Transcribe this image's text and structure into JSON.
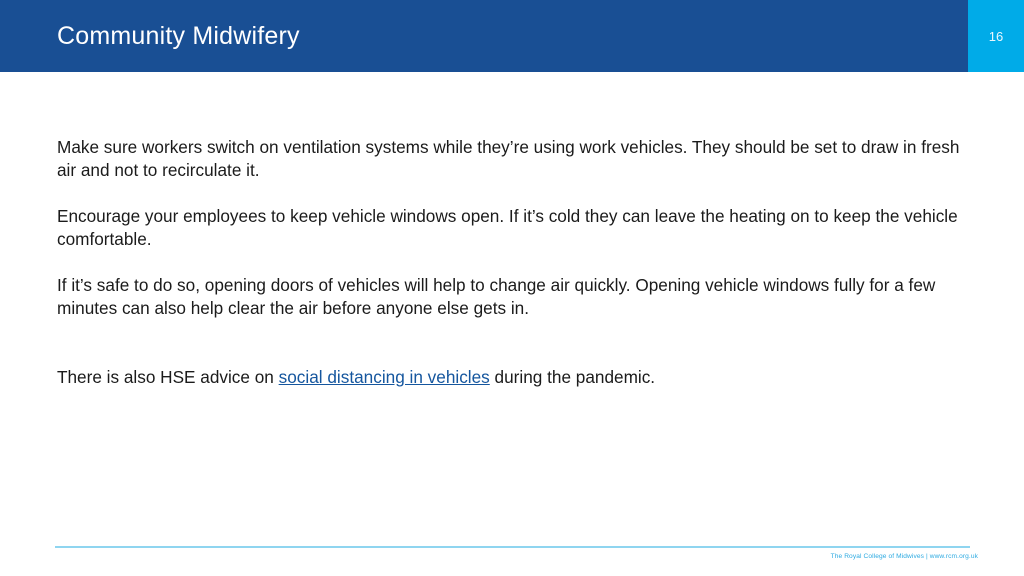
{
  "header": {
    "title": "Community Midwifery",
    "page_number": "16",
    "bar_color": "#194F94",
    "page_block_color": "#00ABE8",
    "title_color": "#FFFFFF"
  },
  "body": {
    "paragraphs": [
      {
        "id": "p1",
        "text": "Make sure workers switch on ventilation systems while they’re using work vehicles. They should be set to draw in fresh air and not to recirculate it."
      },
      {
        "id": "p2",
        "text": "Encourage your employees to keep vehicle windows open. If it’s cold they can leave the heating on to keep the vehicle comfortable."
      },
      {
        "id": "p3",
        "text": "If it’s safe to do so, opening doors of vehicles will help to change air quickly. Opening vehicle windows fully for a few minutes can also help clear the air before anyone else gets in."
      }
    ],
    "link_paragraph": {
      "prefix": "There is also HSE advice on ",
      "link_text": "social distancing in vehicles",
      "suffix": " during the pandemic.",
      "link_color": "#15569E"
    },
    "text_color": "#1B1B1B"
  },
  "footer": {
    "organisation": "The Royal College of Midwives",
    "separator": " | ",
    "website": "www.rcm.org.uk",
    "rule_color": "#8FD5F0",
    "text_color": "#2DAAE1"
  }
}
